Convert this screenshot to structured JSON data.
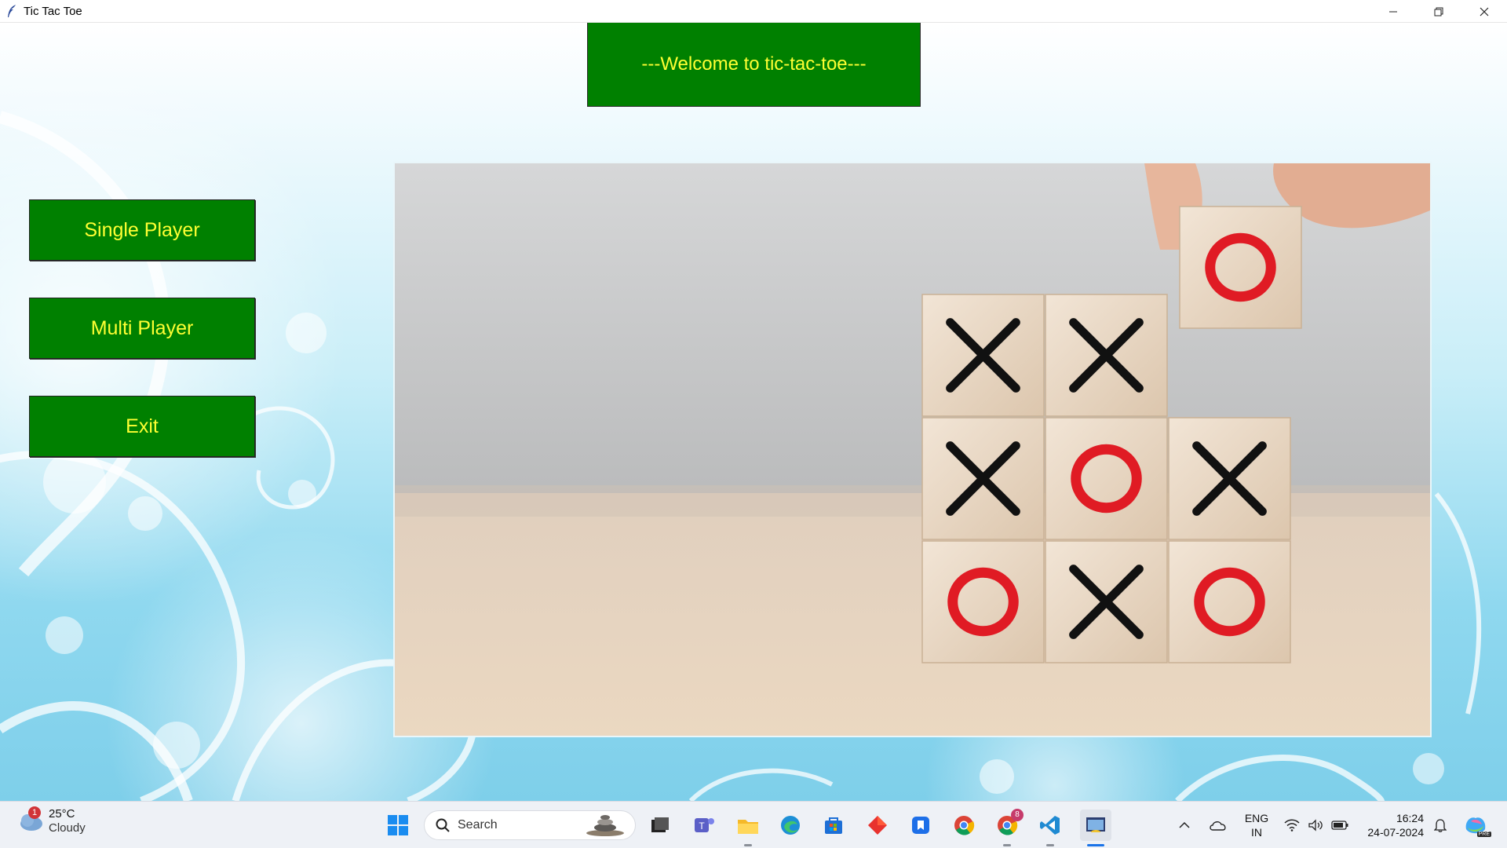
{
  "window": {
    "title": "Tic Tac Toe"
  },
  "app": {
    "welcome_text": "---Welcome to tic-tac-toe---",
    "buttons": {
      "single_player": "Single Player",
      "multi_player": "Multi Player",
      "exit": "Exit"
    },
    "colors": {
      "button_bg": "#008000",
      "button_text": "#ffff33"
    },
    "board": {
      "lifted_tile": "O",
      "grid": [
        [
          "X",
          "X",
          ""
        ],
        [
          "X",
          "O",
          "X"
        ],
        [
          "O",
          "X",
          "O"
        ]
      ]
    }
  },
  "taskbar": {
    "weather": {
      "temp": "25°C",
      "condition": "Cloudy",
      "badge": "1"
    },
    "search_placeholder": "Search",
    "chrome_badge": "8",
    "tray": {
      "lang_top": "ENG",
      "lang_bottom": "IN",
      "time": "16:24",
      "date": "24-07-2024"
    },
    "copilot_label": "PRE"
  }
}
